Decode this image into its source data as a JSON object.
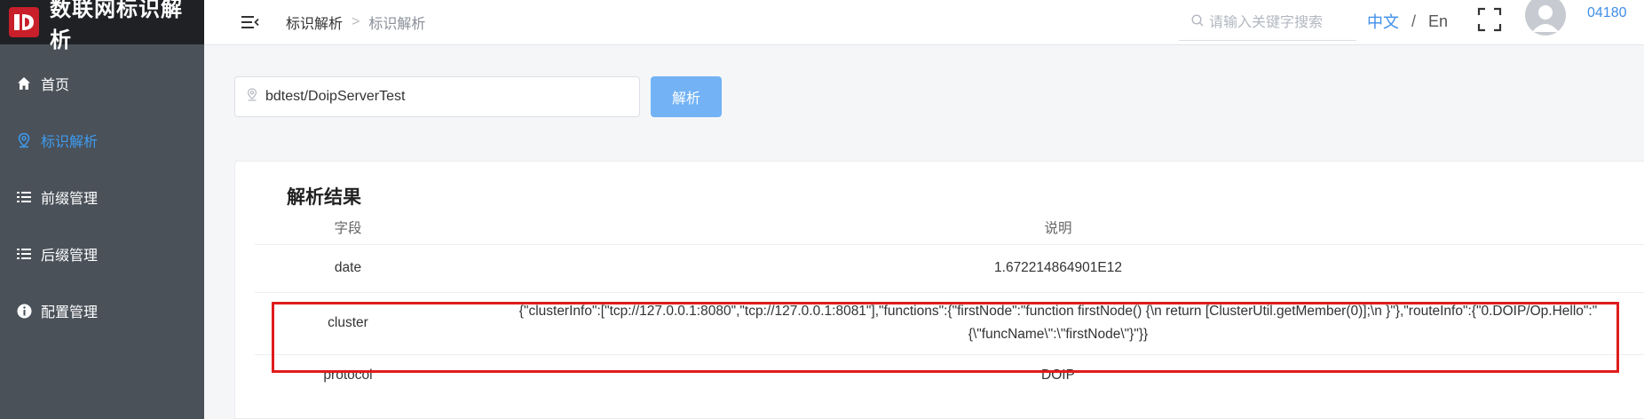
{
  "brand": {
    "title": "数联网标识解析"
  },
  "sidebar": {
    "items": [
      {
        "label": "首页",
        "icon": "home-icon"
      },
      {
        "label": "标识解析",
        "icon": "location-icon"
      },
      {
        "label": "前缀管理",
        "icon": "list-icon"
      },
      {
        "label": "后缀管理",
        "icon": "list-icon"
      },
      {
        "label": "配置管理",
        "icon": "info-icon"
      }
    ],
    "active_color": "#3f9cf0"
  },
  "header": {
    "breadcrumb": [
      "标识解析",
      "标识解析"
    ],
    "search_placeholder": "请输入关键字搜索",
    "lang_zh": "中文",
    "lang_sep": "/",
    "lang_en": "En",
    "user_id": "04180"
  },
  "main": {
    "search_value": "bdtest/DoipServerTest",
    "parse_button": "解析",
    "result_title": "解析结果",
    "columns": [
      "字段",
      "说明"
    ],
    "rows": [
      {
        "field": "date",
        "desc": "1.672214864901E12"
      },
      {
        "field": "cluster",
        "desc_line1": "{\"clusterInfo\":[\"tcp://127.0.0.1:8080\",\"tcp://127.0.0.1:8081\"],\"functions\":{\"firstNode\":\"function firstNode() {\\n return [ClusterUtil.getMember(0)];\\n }\"},\"routeInfo\":{\"0.DOIP/Op.Hello\":\"",
        "desc_line2": "{\\\"funcName\\\":\\\"firstNode\\\"}\"}}"
      },
      {
        "field": "protocol",
        "desc": "DOIP"
      }
    ]
  },
  "colors": {
    "sidebar_bg": "#4a5159",
    "brand_bg": "#1f2124",
    "accent": "#3f8ee8",
    "button": "#72b2f5",
    "highlight": "#e01c1c"
  }
}
